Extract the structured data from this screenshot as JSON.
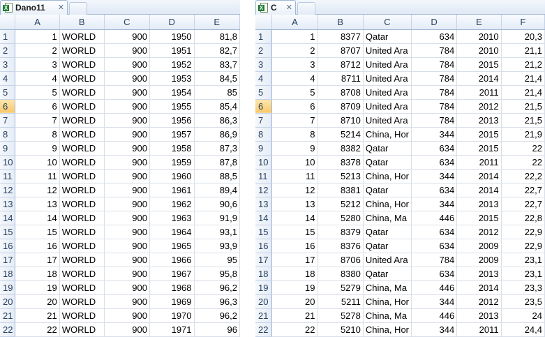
{
  "left": {
    "tab_title": "Dano11",
    "columns": [
      "A",
      "B",
      "C",
      "D",
      "E"
    ],
    "rows": [
      {
        "n": "1",
        "cells": [
          "1",
          "WORLD",
          "900",
          "1950",
          "81,8"
        ]
      },
      {
        "n": "2",
        "cells": [
          "2",
          "WORLD",
          "900",
          "1951",
          "82,7"
        ]
      },
      {
        "n": "3",
        "cells": [
          "3",
          "WORLD",
          "900",
          "1952",
          "83,7"
        ]
      },
      {
        "n": "4",
        "cells": [
          "4",
          "WORLD",
          "900",
          "1953",
          "84,5"
        ]
      },
      {
        "n": "5",
        "cells": [
          "5",
          "WORLD",
          "900",
          "1954",
          "85"
        ]
      },
      {
        "n": "6",
        "cells": [
          "6",
          "WORLD",
          "900",
          "1955",
          "85,4"
        ]
      },
      {
        "n": "7",
        "cells": [
          "7",
          "WORLD",
          "900",
          "1956",
          "86,3"
        ]
      },
      {
        "n": "8",
        "cells": [
          "8",
          "WORLD",
          "900",
          "1957",
          "86,9"
        ]
      },
      {
        "n": "9",
        "cells": [
          "9",
          "WORLD",
          "900",
          "1958",
          "87,3"
        ]
      },
      {
        "n": "10",
        "cells": [
          "10",
          "WORLD",
          "900",
          "1959",
          "87,8"
        ]
      },
      {
        "n": "11",
        "cells": [
          "11",
          "WORLD",
          "900",
          "1960",
          "88,5"
        ]
      },
      {
        "n": "12",
        "cells": [
          "12",
          "WORLD",
          "900",
          "1961",
          "89,4"
        ]
      },
      {
        "n": "13",
        "cells": [
          "13",
          "WORLD",
          "900",
          "1962",
          "90,6"
        ]
      },
      {
        "n": "14",
        "cells": [
          "14",
          "WORLD",
          "900",
          "1963",
          "91,9"
        ]
      },
      {
        "n": "15",
        "cells": [
          "15",
          "WORLD",
          "900",
          "1964",
          "93,1"
        ]
      },
      {
        "n": "16",
        "cells": [
          "16",
          "WORLD",
          "900",
          "1965",
          "93,9"
        ]
      },
      {
        "n": "17",
        "cells": [
          "17",
          "WORLD",
          "900",
          "1966",
          "95"
        ]
      },
      {
        "n": "18",
        "cells": [
          "18",
          "WORLD",
          "900",
          "1967",
          "95,8"
        ]
      },
      {
        "n": "19",
        "cells": [
          "19",
          "WORLD",
          "900",
          "1968",
          "96,2"
        ]
      },
      {
        "n": "20",
        "cells": [
          "20",
          "WORLD",
          "900",
          "1969",
          "96,3"
        ]
      },
      {
        "n": "21",
        "cells": [
          "21",
          "WORLD",
          "900",
          "1970",
          "96,2"
        ]
      },
      {
        "n": "22",
        "cells": [
          "22",
          "WORLD",
          "900",
          "1971",
          "96"
        ]
      }
    ]
  },
  "right": {
    "tab_title": "C",
    "columns": [
      "A",
      "B",
      "C",
      "D",
      "E",
      "F"
    ],
    "rows": [
      {
        "n": "1",
        "cells": [
          "1",
          "8377",
          "Qatar",
          "634",
          "2010",
          "20,3"
        ]
      },
      {
        "n": "2",
        "cells": [
          "2",
          "8707",
          "United Ara",
          "784",
          "2010",
          "21,1"
        ]
      },
      {
        "n": "3",
        "cells": [
          "3",
          "8712",
          "United Ara",
          "784",
          "2015",
          "21,2"
        ]
      },
      {
        "n": "4",
        "cells": [
          "4",
          "8711",
          "United Ara",
          "784",
          "2014",
          "21,4"
        ]
      },
      {
        "n": "5",
        "cells": [
          "5",
          "8708",
          "United Ara",
          "784",
          "2011",
          "21,4"
        ]
      },
      {
        "n": "6",
        "cells": [
          "6",
          "8709",
          "United Ara",
          "784",
          "2012",
          "21,5"
        ]
      },
      {
        "n": "7",
        "cells": [
          "7",
          "8710",
          "United Ara",
          "784",
          "2013",
          "21,5"
        ]
      },
      {
        "n": "8",
        "cells": [
          "8",
          "5214",
          "China, Hor",
          "344",
          "2015",
          "21,9"
        ]
      },
      {
        "n": "9",
        "cells": [
          "9",
          "8382",
          "Qatar",
          "634",
          "2015",
          "22"
        ]
      },
      {
        "n": "10",
        "cells": [
          "10",
          "8378",
          "Qatar",
          "634",
          "2011",
          "22"
        ]
      },
      {
        "n": "11",
        "cells": [
          "11",
          "5213",
          "China, Hor",
          "344",
          "2014",
          "22,2"
        ]
      },
      {
        "n": "12",
        "cells": [
          "12",
          "8381",
          "Qatar",
          "634",
          "2014",
          "22,7"
        ]
      },
      {
        "n": "13",
        "cells": [
          "13",
          "5212",
          "China, Hor",
          "344",
          "2013",
          "22,7"
        ]
      },
      {
        "n": "14",
        "cells": [
          "14",
          "5280",
          "China, Ma",
          "446",
          "2015",
          "22,8"
        ]
      },
      {
        "n": "15",
        "cells": [
          "15",
          "8379",
          "Qatar",
          "634",
          "2012",
          "22,9"
        ]
      },
      {
        "n": "16",
        "cells": [
          "16",
          "8376",
          "Qatar",
          "634",
          "2009",
          "22,9"
        ]
      },
      {
        "n": "17",
        "cells": [
          "17",
          "8706",
          "United Ara",
          "784",
          "2009",
          "23,1"
        ]
      },
      {
        "n": "18",
        "cells": [
          "18",
          "8380",
          "Qatar",
          "634",
          "2013",
          "23,1"
        ]
      },
      {
        "n": "19",
        "cells": [
          "19",
          "5279",
          "China, Ma",
          "446",
          "2014",
          "23,3"
        ]
      },
      {
        "n": "20",
        "cells": [
          "20",
          "5211",
          "China, Hor",
          "344",
          "2012",
          "23,5"
        ]
      },
      {
        "n": "21",
        "cells": [
          "21",
          "5278",
          "China, Ma",
          "446",
          "2013",
          "24"
        ]
      },
      {
        "n": "22",
        "cells": [
          "22",
          "5210",
          "China, Hor",
          "344",
          "2011",
          "24,4"
        ]
      }
    ]
  },
  "selected_row_header": "6",
  "icons": {
    "workbook": "excel-workbook-icon",
    "close": "close-x-icon"
  },
  "colors": {
    "header_bg": "#e4ecf7",
    "selected_header": "#f8c96c",
    "gridline": "#d9dfe8",
    "excel_green": "#1e7b34"
  }
}
